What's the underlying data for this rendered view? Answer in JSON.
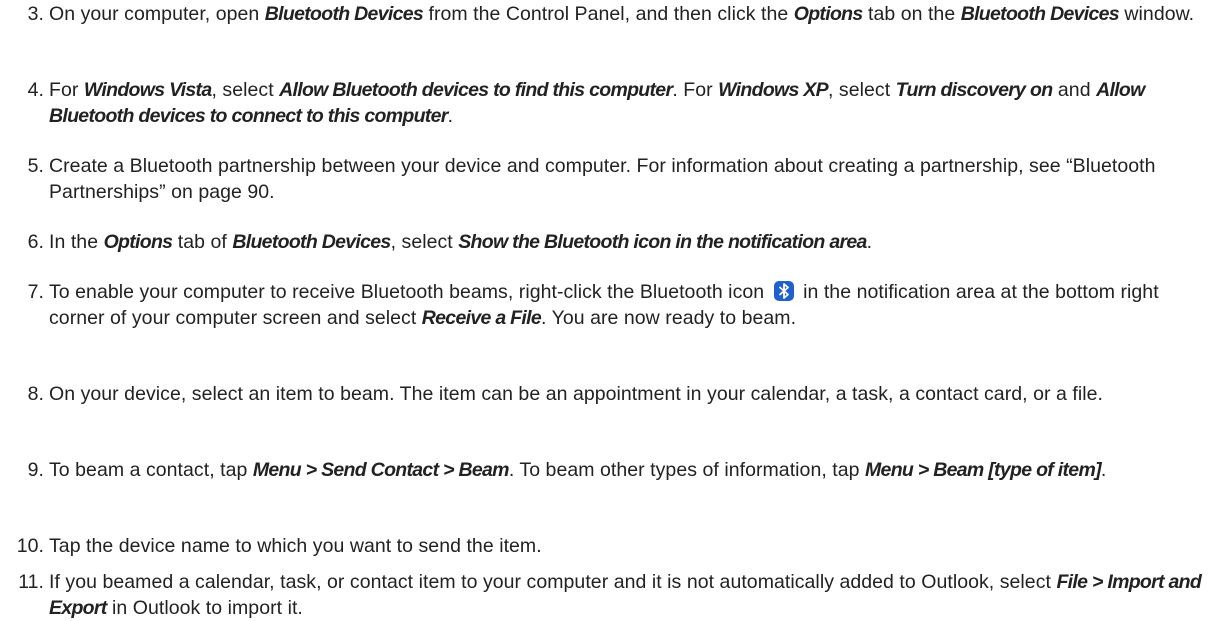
{
  "steps": [
    {
      "num": "3.",
      "parts": [
        {
          "t": "On your computer, open "
        },
        {
          "t": "Bluetooth Devices",
          "em": true
        },
        {
          "t": " from the Control Panel, and then click the "
        },
        {
          "t": "Options",
          "em": true
        },
        {
          "t": " tab on the "
        },
        {
          "t": "Bluetooth Devices",
          "em": true
        },
        {
          "t": " window."
        }
      ]
    },
    {
      "num": "4.",
      "parts": [
        {
          "t": "For "
        },
        {
          "t": "Windows Vista",
          "em": true
        },
        {
          "t": ", select "
        },
        {
          "t": "Allow Bluetooth devices to find this computer",
          "em": true
        },
        {
          "t": ". For "
        },
        {
          "t": "Windows XP",
          "em": true
        },
        {
          "t": ", select "
        },
        {
          "t": "Turn discovery on",
          "em": true
        },
        {
          "t": " and "
        },
        {
          "t": "Allow Bluetooth devices to connect to this computer",
          "em": true
        },
        {
          "t": "."
        }
      ]
    },
    {
      "num": "5.",
      "parts": [
        {
          "t": "Create a Bluetooth partnership between your device and computer. For information about creating a partnership, see “Bluetooth Partnerships” on page 90."
        }
      ]
    },
    {
      "num": "6.",
      "parts": [
        {
          "t": "In the "
        },
        {
          "t": "Options",
          "em": true
        },
        {
          "t": " tab of "
        },
        {
          "t": "Bluetooth Devices",
          "em": true
        },
        {
          "t": ", select "
        },
        {
          "t": "Show the Bluetooth icon in the notification area",
          "em": true
        },
        {
          "t": "."
        }
      ]
    },
    {
      "num": "7.",
      "parts": [
        {
          "t": "To enable your computer to receive Bluetooth beams, right-click the Bluetooth icon "
        },
        {
          "icon": "bluetooth-icon"
        },
        {
          "t": " in the notification area at the bottom right corner of your computer screen and select "
        },
        {
          "t": "Receive a File",
          "em": true
        },
        {
          "t": ". You are now ready to beam."
        }
      ]
    },
    {
      "num": "8.",
      "parts": [
        {
          "t": "On your device, select an item to beam. The item can be an appointment in your calendar, a task, a contact card, or a file."
        }
      ]
    },
    {
      "num": "9.",
      "parts": [
        {
          "t": "To beam a contact, tap "
        },
        {
          "t": "Menu > Send Contact > Beam",
          "em": true
        },
        {
          "t": ". To beam other types of information, tap "
        },
        {
          "t": "Menu > Beam [type of item]",
          "em": true
        },
        {
          "t": "."
        }
      ]
    },
    {
      "num": "10.",
      "parts": [
        {
          "t": "Tap the device name to which you want to send the item."
        }
      ]
    },
    {
      "num": "11.",
      "parts": [
        {
          "t": "If you beamed a calendar, task, or contact item to your computer and it is not automatically added to Outlook, select "
        },
        {
          "t": "File > Import and Export",
          "em": true
        },
        {
          "t": " in Outlook to import it."
        }
      ]
    }
  ],
  "icon_colors": {
    "bluetooth_bg": "#1f5fd0",
    "bluetooth_glyph": "#ffffff"
  }
}
